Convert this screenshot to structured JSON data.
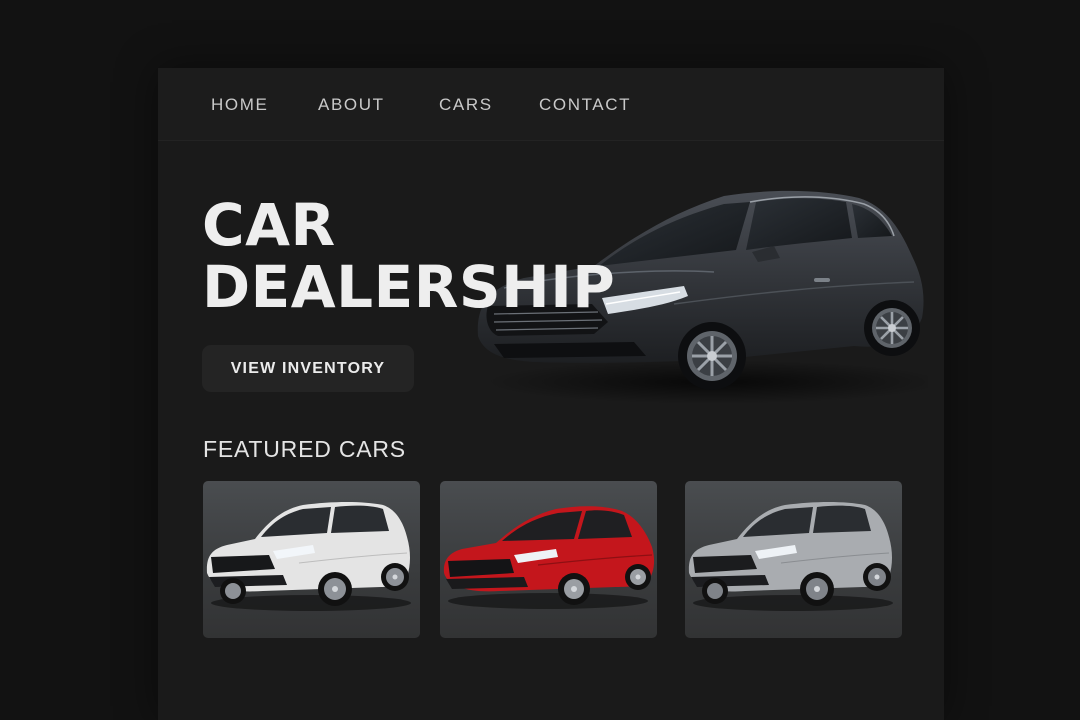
{
  "nav": {
    "items": [
      {
        "label": "HOME"
      },
      {
        "label": "ABOUT"
      },
      {
        "label": "CARS"
      },
      {
        "label": "CONTACT"
      }
    ]
  },
  "hero": {
    "title_line1": "CAR",
    "title_line2": "DEALERSHIP",
    "cta_label": "VIEW INVENTORY",
    "car_color": "#3a3d42"
  },
  "featured": {
    "title": "FEATURED CARS",
    "cars": [
      {
        "type": "suv",
        "color": "#e4e4e4"
      },
      {
        "type": "sedan",
        "color": "#c4161c"
      },
      {
        "type": "suv",
        "color": "#a9acb0"
      }
    ]
  }
}
